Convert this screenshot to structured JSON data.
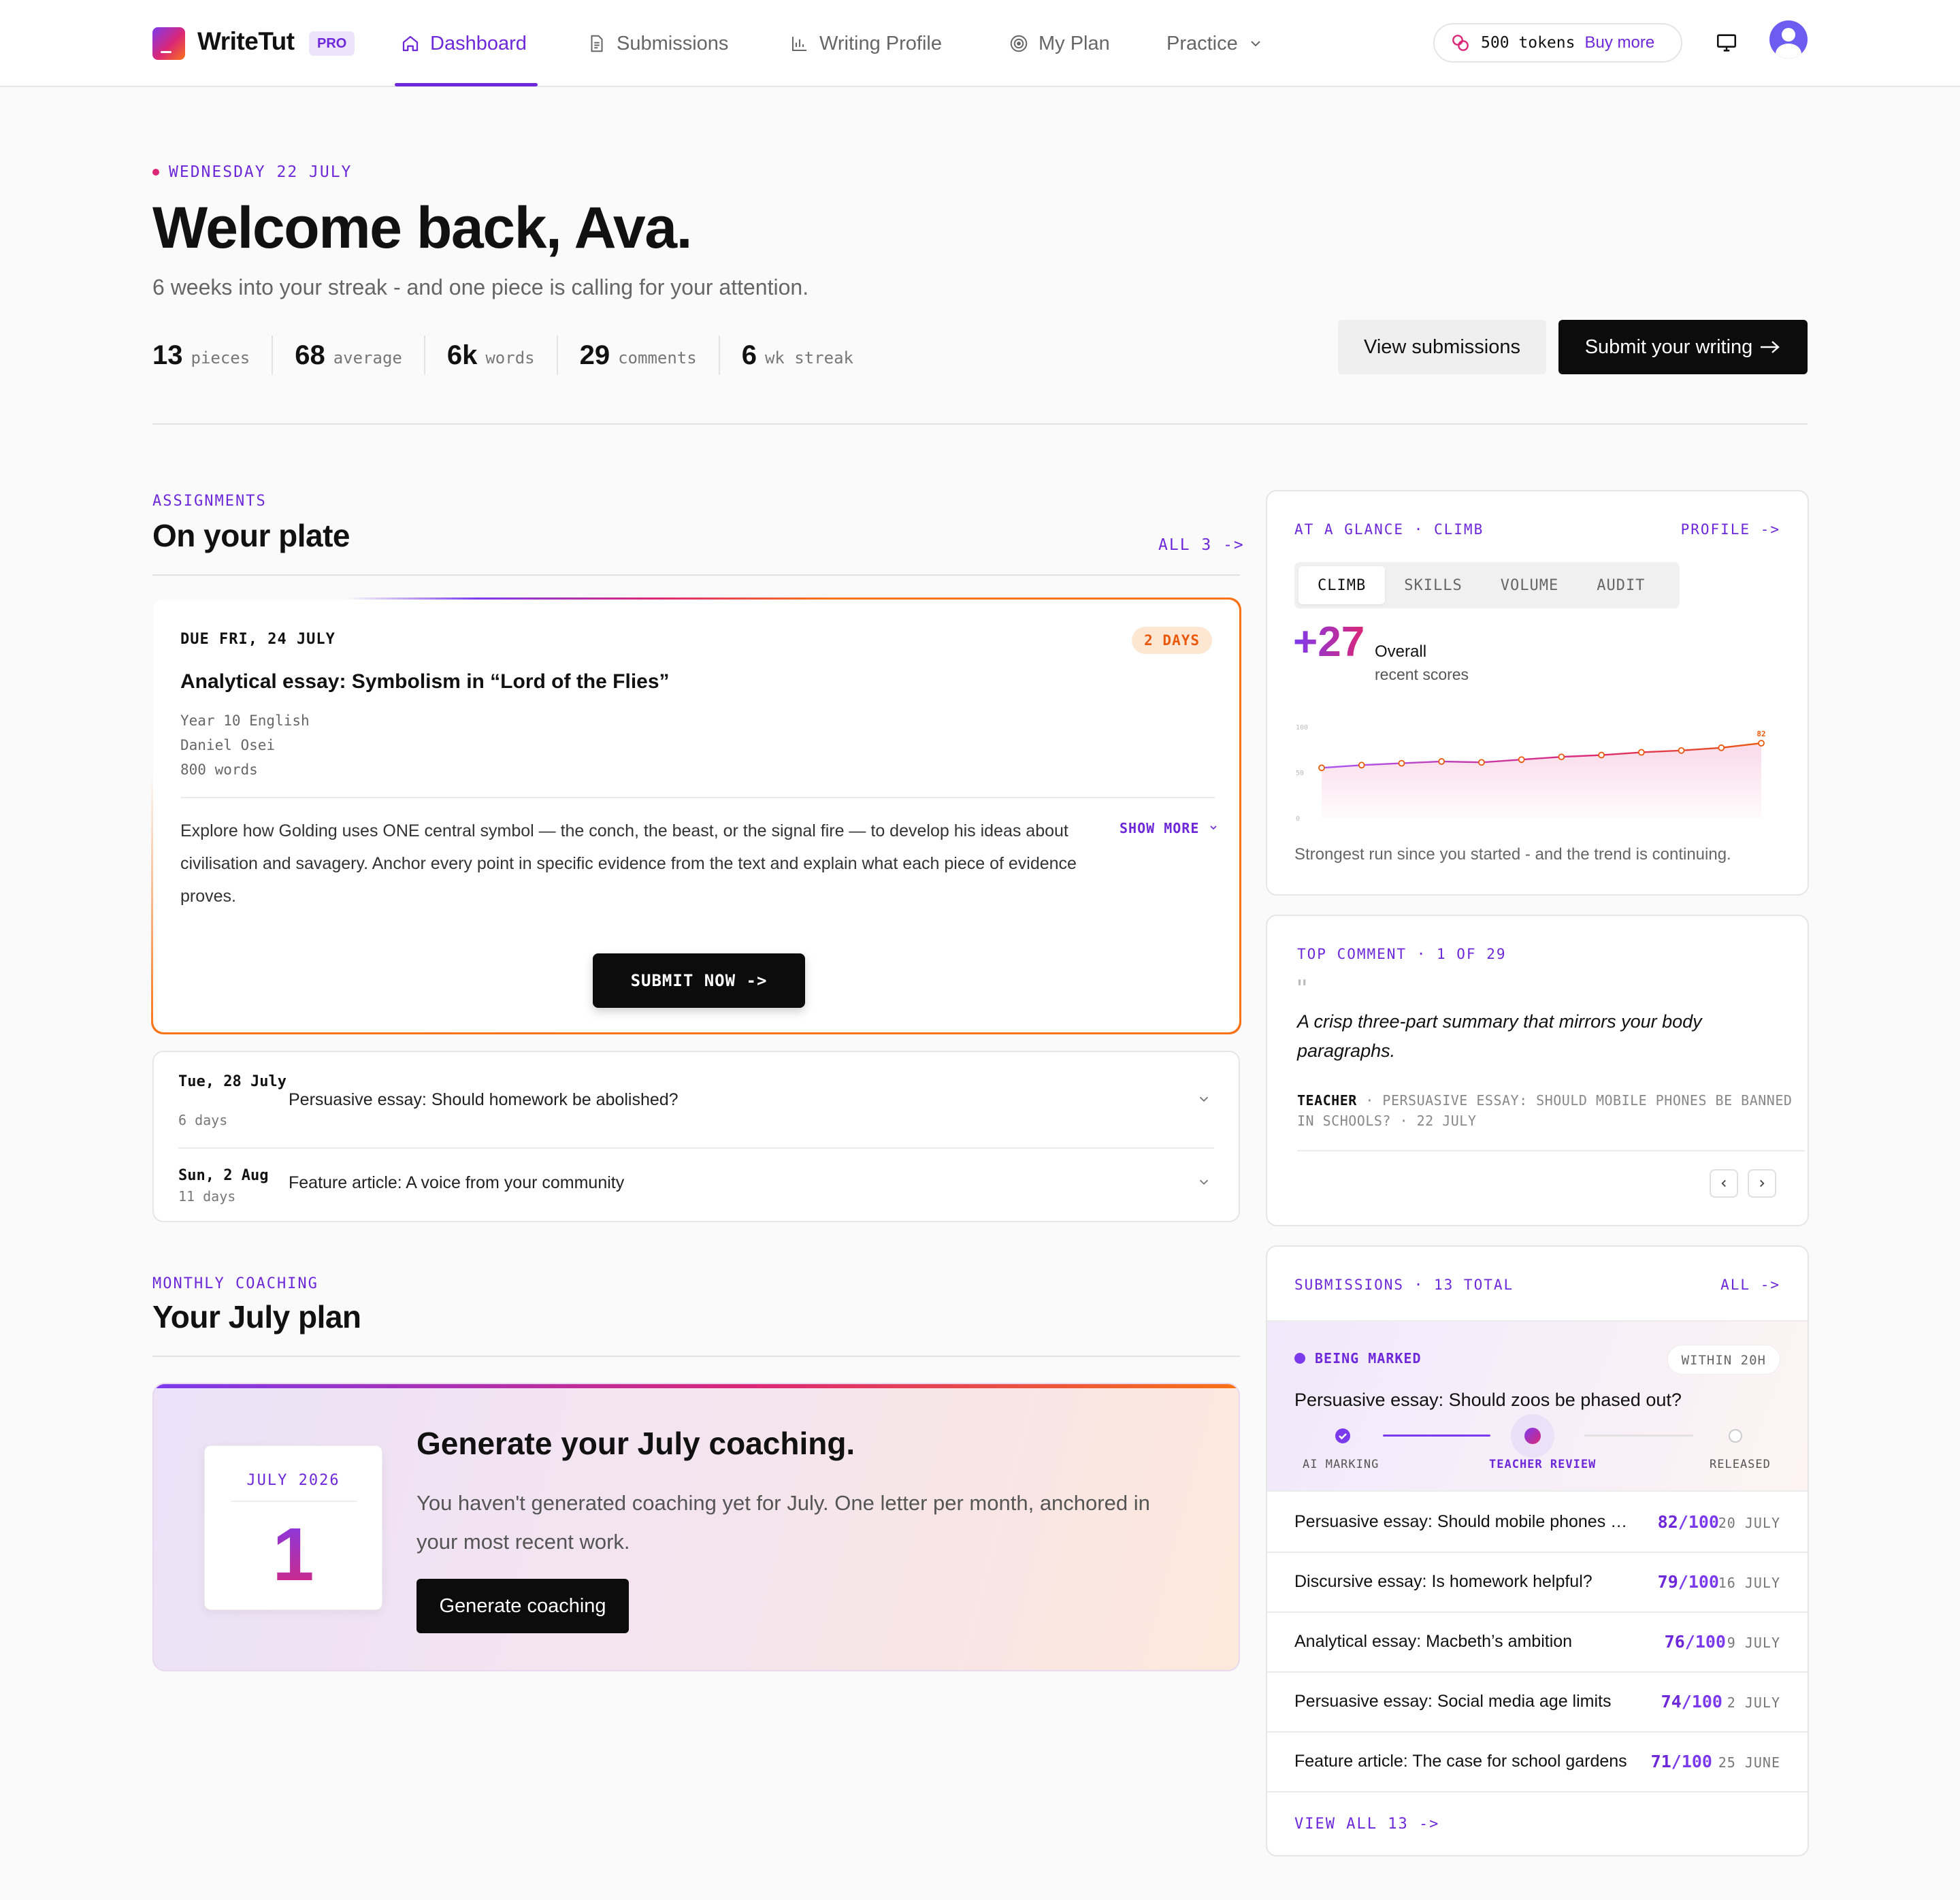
{
  "nav": {
    "brand": "WriteTut",
    "badge": "PRO",
    "items": [
      {
        "label": "Dashboard",
        "icon": "home-icon",
        "active": true
      },
      {
        "label": "Submissions",
        "icon": "document-icon"
      },
      {
        "label": "Writing Profile",
        "icon": "bar-chart-icon"
      },
      {
        "label": "My Plan",
        "icon": "target-icon"
      },
      {
        "label": "Practice",
        "icon": "chevron-down-icon"
      }
    ],
    "tokens": "500 tokens",
    "buy_more": "Buy more",
    "accent": "#6d28d9"
  },
  "hero": {
    "date": "WEDNESDAY 22 JULY",
    "welcome": "Welcome back, Ava.",
    "subline": "6 weeks into your streak - and one piece is calling for your attention.",
    "stats": [
      {
        "value": "13",
        "label": "pieces"
      },
      {
        "value": "68",
        "label": "average"
      },
      {
        "value": "6k",
        "label": "words"
      },
      {
        "value": "29",
        "label": "comments"
      },
      {
        "value": "6",
        "label": "wk streak"
      }
    ],
    "view_submissions": "View submissions",
    "submit_writing": "Submit your writing"
  },
  "assignments": {
    "eyebrow": "ASSIGNMENTS",
    "title": "On your plate",
    "all_link": "ALL 3 ->",
    "featured": {
      "due": "DUE FRI, 24 JULY",
      "badge": "2 DAYS",
      "title": "Analytical essay: Symbolism in “Lord of the Flies”",
      "course": "Year 10 English",
      "teacher": "Daniel Osei",
      "words": "800 words",
      "description": "Explore how Golding uses ONE central symbol — the conch, the beast, or the signal fire — to develop his ideas about civilisation and savagery. Anchor every point in specific evidence from the text and explain what each piece of evidence proves.",
      "show_more": "SHOW MORE",
      "submit": "SUBMIT NOW ->"
    },
    "upcoming": [
      {
        "date": "Tue, 28 July",
        "days": "6 days",
        "title": "Persuasive essay: Should homework be abolished?"
      },
      {
        "date": "Sun, 2 Aug",
        "days": "11 days",
        "title": "Feature article: A voice from your community"
      }
    ]
  },
  "coaching": {
    "eyebrow": "MONTHLY COACHING",
    "title": "Your July plan",
    "card_title": "Generate your July coaching.",
    "body": "You haven't generated coaching yet for July. One letter per month, anchored in your most recent work.",
    "button": "Generate coaching",
    "cal_month": "JULY 2026",
    "cal_day": "1"
  },
  "glance": {
    "eyebrow": "AT A GLANCE · CLIMB",
    "profile_link": "PROFILE ->",
    "tabs": [
      "CLIMB",
      "SKILLS",
      "VOLUME",
      "AUDIT"
    ],
    "delta": "+27",
    "delta_label": "Overall",
    "delta_sub": "recent scores",
    "caption": "Strongest run since you started - and the trend is continuing."
  },
  "chart_data": {
    "type": "area",
    "x": [
      1,
      2,
      3,
      4,
      5,
      6,
      7,
      8,
      9,
      10,
      11,
      12
    ],
    "values": [
      55,
      58,
      60,
      62,
      61,
      64,
      67,
      69,
      72,
      74,
      77,
      82
    ],
    "ylim": [
      0,
      100
    ],
    "yticks": [
      "100",
      "50",
      "0"
    ],
    "end_label": "82",
    "line_color": "#db2777",
    "fill_color": "#f9d6e6"
  },
  "comment": {
    "eyebrow": "TOP COMMENT · 1 OF 29",
    "quote_mark": "\"",
    "text": "A crisp three-part summary that mirrors your body paragraphs.",
    "author": "TEACHER",
    "context": "· PERSUASIVE ESSAY: SHOULD MOBILE PHONES BE BANNED IN SCHOOLS? · 22 JULY"
  },
  "submissions": {
    "eyebrow": "SUBMISSIONS · 13 TOTAL",
    "all_link": "ALL ->",
    "marking": {
      "status": "BEING MARKED",
      "badge": "WITHIN 20H",
      "title": "Persuasive essay: Should zoos be phased out?",
      "steps": [
        "AI MARKING",
        "TEACHER REVIEW",
        "RELEASED"
      ],
      "current_step": 2
    },
    "rows": [
      {
        "title": "Persuasive essay: Should mobile phones be banned in schools?",
        "score": "82",
        "out_of": "/100",
        "date": "20 JULY"
      },
      {
        "title": "Discursive essay: Is homework helpful?",
        "score": "79",
        "out_of": "/100",
        "date": "16 JULY"
      },
      {
        "title": "Analytical essay: Macbeth’s ambition",
        "score": "76",
        "out_of": "/100",
        "date": "9 JULY"
      },
      {
        "title": "Persuasive essay: Social media age limits",
        "score": "74",
        "out_of": "/100",
        "date": "2 JULY"
      },
      {
        "title": "Feature article: The case for school gardens",
        "score": "71",
        "out_of": "/100",
        "date": "25 JUNE"
      }
    ],
    "view_all": "VIEW ALL 13 ->"
  }
}
